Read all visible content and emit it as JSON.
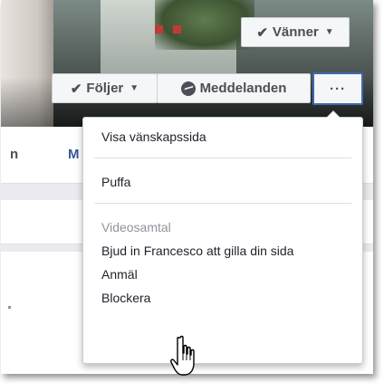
{
  "profile": {
    "friends_button": {
      "label": "Vänner",
      "check_icon": "check-icon",
      "caret_icon": "caret-down-icon"
    },
    "follow_button": {
      "label": "Följer",
      "check_icon": "check-icon",
      "caret_icon": "caret-down-icon"
    },
    "message_button": {
      "label": "Meddelanden",
      "icon": "messenger-icon"
    },
    "more_button": {
      "label": "···"
    }
  },
  "nav": {
    "partial_left": "n",
    "partial_m": "M"
  },
  "menu": {
    "items": [
      {
        "label": "Visa vänskapssida"
      },
      {
        "label": "Puffa"
      },
      {
        "label": "Videosamtal",
        "disabled": true
      },
      {
        "label": "Bjud in Francesco att gilla din sida"
      },
      {
        "label": "Anmäl"
      },
      {
        "label": "Blockera"
      }
    ]
  },
  "colors": {
    "accent": "#4267b2",
    "link": "#365899",
    "disabled": "#90949c",
    "text": "#1d2129"
  }
}
